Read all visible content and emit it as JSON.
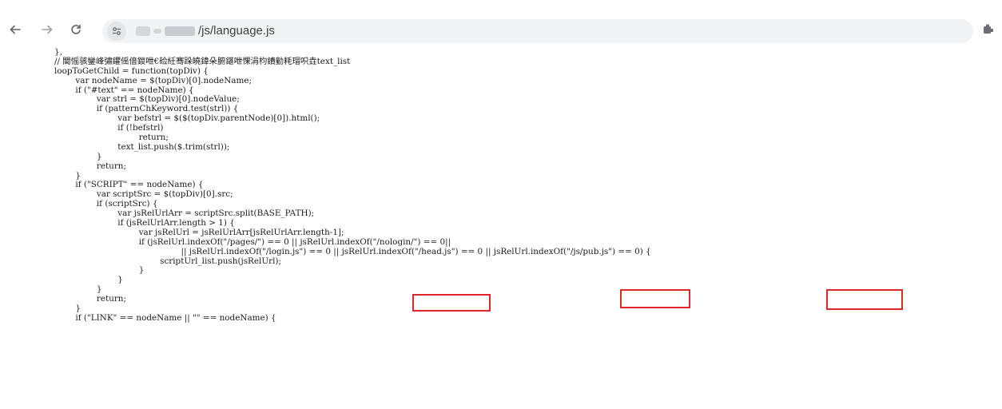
{
  "browser": {
    "back_icon": "arrow-left-icon",
    "forward_icon": "arrow-right-icon",
    "reload_icon": "reload-icon",
    "site_info_icon": "tune-icon",
    "address_path": "/js/language.js",
    "extension_icon": "extension-icon"
  },
  "code_lines": [
    "},",
    "// 閫愮骇鑾峰彇鑺傜偣鍐呭€硷紝骞跺皢鍏朵腑鍖呭惈涓枃鐨勭粍瑁呮垚text_list",
    "loopToGetChild = function(topDiv) {",
    "        var nodeName = $(topDiv)[0].nodeName;",
    "        if (\"#text\" == nodeName) {",
    "                var strl = $(topDiv)[0].nodeValue;",
    "                if (patternChKeyword.test(strl)) {",
    "                        var befstrl = $($(topDiv.parentNode)[0]).html();",
    "                        if (!befstrl)",
    "                                return;",
    "                        text_list.push($.trim(strl));",
    "                }",
    "                return;",
    "        }",
    "        if (\"SCRIPT\" == nodeName) {",
    "                var scriptSrc = $(topDiv)[0].src;",
    "                if (scriptSrc) {",
    "                        var jsRelUrlArr = scriptSrc.split(BASE_PATH);",
    "                        if (jsRelUrlArr.length > 1) {",
    "                                var jsRelUrl = jsRelUrlArr[jsRelUrlArr.length-1];",
    "                                if (jsRelUrl.indexOf(\"/pages/\") == 0 || jsRelUrl.indexOf(\"/nologin/\") == 0||",
    "                                                || jsRelUrl.indexOf(\"/login.js\") == 0 || jsRelUrl.indexOf(\"/head.js\") == 0 || jsRelUrl.indexOf(\"/js/pub.js\") == 0) {",
    "                                        scriptUrl_list.push(jsRelUrl);",
    "                                }",
    "                        }",
    "                }",
    "                return;",
    "        }",
    "        if (\"LINK\" == nodeName || \"\" == nodeName) {"
  ],
  "highlight_color": "#e0262b"
}
